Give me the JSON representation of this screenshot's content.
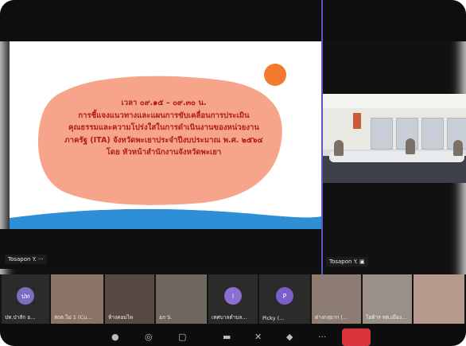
{
  "slide": {
    "lines": [
      "เวลา ๐๙.๑๕ – ๐๙.๓๐ น.",
      "การชี้แจงแนวทางและแผนการขับเคลื่อนการประเมิน",
      "คุณธรรมและความโปร่งใสในการดำเนินงานของหน่วยงาน",
      "ภาครัฐ (ITA) จังหวัดพะเยาประจำปีงบประมาณ พ.ศ. ๒๕๖๔",
      "โดย หัวหน้าสำนักงานจังหวัดพะเยา"
    ]
  },
  "share_name": "Tosapon Y.",
  "camera_name": "Tosapon Y.",
  "gallery": [
    {
      "name": "ปท.ป่าสัก อ...",
      "initials": "ปท",
      "avatar_color": "#7e6bc4",
      "video": false
    },
    {
      "name": "สถต.ไม่ 1 (Cu...",
      "video": true
    },
    {
      "name": "ห้างคอมไพ",
      "video": true
    },
    {
      "name": "อภ S.",
      "video": true
    },
    {
      "name": "เทศบาลตำบล...",
      "initials": "i",
      "avatar_color": "#8a6fd0",
      "video": false
    },
    {
      "name": "Picky (...",
      "initials": "P",
      "avatar_color": "#7a5fc8",
      "video": false
    },
    {
      "name": "ต่างกลุ่ยาก (...",
      "video": true
    },
    {
      "name": "โยต้าร ทต.เมือง...",
      "video": true
    },
    {
      "name": "",
      "video": true
    }
  ],
  "colors": {
    "divider": "#5a58c8",
    "slide_text": "#b01d1d",
    "blob": "#f6a48a",
    "wave": "#2f8fd6",
    "accent_dot": "#f47a30",
    "leave": "#d9343b"
  }
}
